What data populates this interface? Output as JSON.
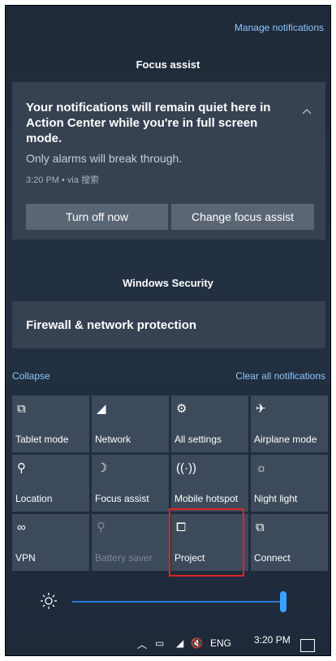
{
  "header": {
    "manage_link": "Manage notifications"
  },
  "focus_assist": {
    "group_title": "Focus assist",
    "message": "Your notifications will remain quiet here in Action Center while you're in full screen mode.",
    "sub_message": "Only alarms will break through.",
    "meta": "3:20 PM • via 搜索",
    "turn_off_label": "Turn off now",
    "change_label": "Change focus assist"
  },
  "windows_security": {
    "group_title": "Windows Security",
    "item": "Firewall & network protection"
  },
  "actions": {
    "collapse_label": "Collapse",
    "clear_all_label": "Clear all notifications"
  },
  "quick_actions": [
    {
      "label": "Tablet mode",
      "icon": "tablet-mode-icon",
      "glyph": "⧉",
      "enabled": true
    },
    {
      "label": "Network",
      "icon": "network-icon",
      "glyph": "◢",
      "enabled": true
    },
    {
      "label": "All settings",
      "icon": "gear-icon",
      "glyph": "⚙",
      "enabled": true
    },
    {
      "label": "Airplane mode",
      "icon": "airplane-icon",
      "glyph": "✈",
      "enabled": true
    },
    {
      "label": "Location",
      "icon": "location-icon",
      "glyph": "⚲",
      "enabled": true
    },
    {
      "label": "Focus assist",
      "icon": "moon-icon",
      "glyph": "☽",
      "enabled": true
    },
    {
      "label": "Mobile hotspot",
      "icon": "hotspot-icon",
      "glyph": "((·))",
      "enabled": true
    },
    {
      "label": "Night light",
      "icon": "night-light-icon",
      "glyph": "☼",
      "enabled": true
    },
    {
      "label": "VPN",
      "icon": "vpn-icon",
      "glyph": "∞",
      "enabled": true
    },
    {
      "label": "Battery saver",
      "icon": "battery-saver-icon",
      "glyph": "⚲",
      "enabled": false
    },
    {
      "label": "Project",
      "icon": "project-icon",
      "glyph": "⧠",
      "enabled": true
    },
    {
      "label": "Connect",
      "icon": "connect-icon",
      "glyph": "⧉",
      "enabled": true
    }
  ],
  "brightness": {
    "level_percent": 100
  },
  "taskbar": {
    "lang": "ENG",
    "time": "3:20 PM"
  },
  "colors": {
    "accent": "#3aa0ff",
    "link": "#8cc8ff",
    "highlight": "#e02424"
  }
}
